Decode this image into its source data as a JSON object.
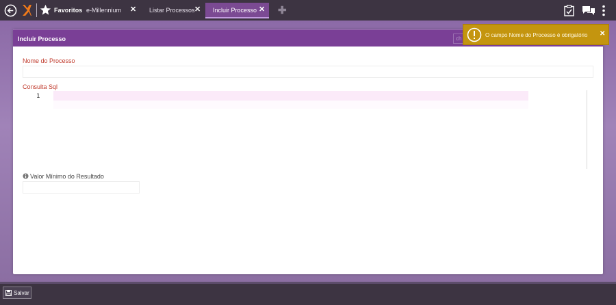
{
  "topbar": {
    "favorites_label": "Favoritos",
    "tabs": [
      {
        "label": "e-Millennium",
        "closable": true
      },
      {
        "label": "Listar Processos",
        "closable": true
      },
      {
        "label": "Incluir Processo",
        "closable": true,
        "active": true
      }
    ],
    "close_glyph": "✕",
    "add_glyph": "✚",
    "icons": [
      "back-icon",
      "logo-icon",
      "star-icon",
      "clipboard-icon",
      "chat-icon",
      "more-icon"
    ]
  },
  "card": {
    "title": "Incluir Processo",
    "header_button_label": "ch",
    "fields": {
      "name_label": "Nome do Processo",
      "name_value": "",
      "sql_label": "Consulta Sql",
      "sql_line_number": "1",
      "sql_value": "",
      "min_label": "Valor Mínimo do Resultado",
      "min_value": ""
    }
  },
  "toast": {
    "message": "O campo Nome do Processo é obrigatório",
    "close_glyph": "✕",
    "icon": "warning-icon"
  },
  "bottombar": {
    "save_label": "Salvar"
  },
  "colors": {
    "accent": "#7a3f96",
    "label_red": "#c0392b",
    "toast_bg": "#c4950f",
    "bar_bg": "#3d3442"
  }
}
